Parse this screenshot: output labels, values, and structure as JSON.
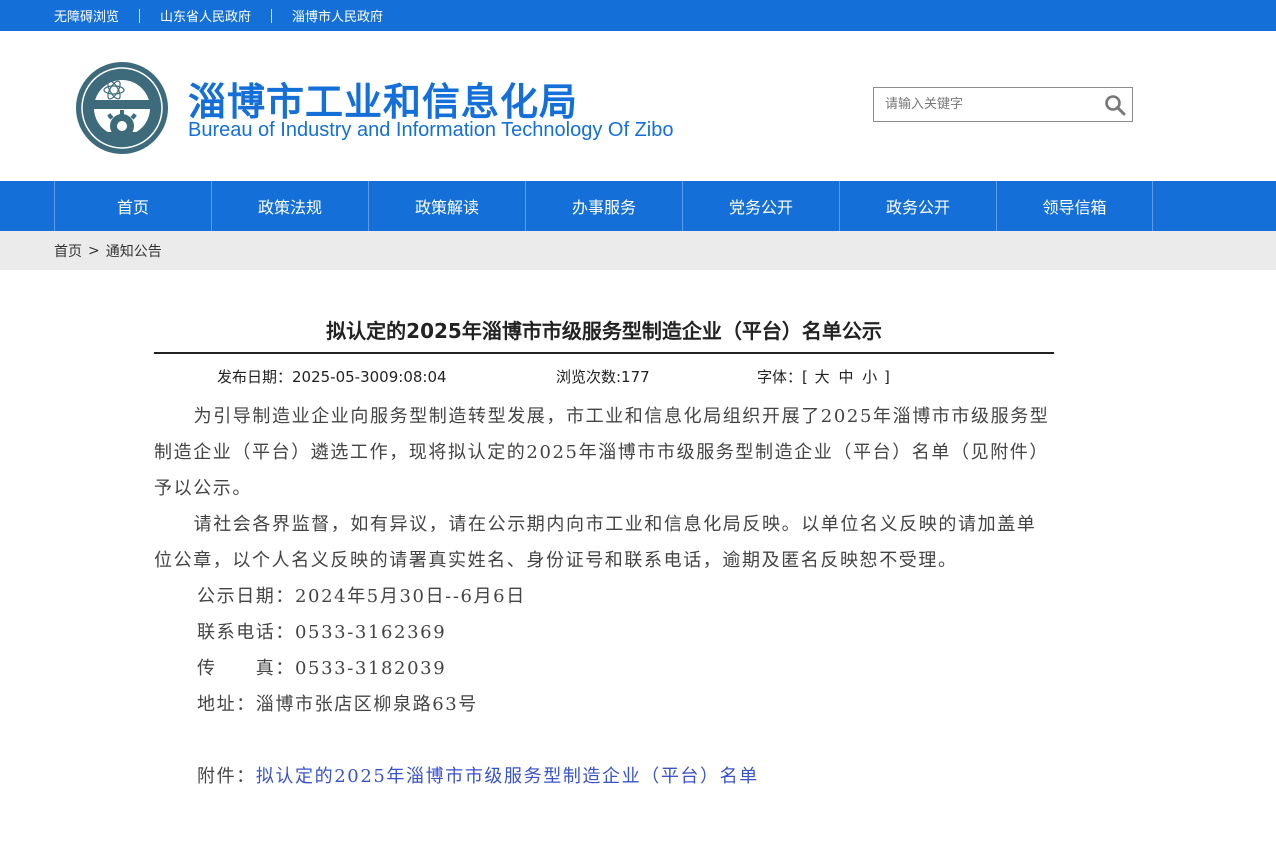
{
  "topbar": {
    "links": [
      "无障碍浏览",
      "山东省人民政府",
      "淄博市人民政府"
    ]
  },
  "header": {
    "title_cn": "淄博市工业和信息化局",
    "title_en": "Bureau of Industry and Information Technology Of Zibo",
    "search_placeholder": "请输入关键字"
  },
  "nav": {
    "items": [
      "首页",
      "政策法规",
      "政策解读",
      "办事服务",
      "党务公开",
      "政务公开",
      "领导信箱"
    ]
  },
  "breadcrumb": {
    "home": "首页",
    "separator": ">",
    "current": "通知公告"
  },
  "article": {
    "title": "拟认定的2025年淄博市市级服务型制造企业（平台）名单公示",
    "publish_date": "发布日期：2025-05-3009:08:04",
    "views": "浏览次数:177",
    "font_label": "字体：[",
    "font_large": "大",
    "font_medium": "中",
    "font_small": "小",
    "font_close": "]",
    "paragraph1": "为引导制造业企业向服务型制造转型发展，市工业和信息化局组织开展了2025年淄博市市级服务型制造企业（平台）遴选工作，现将拟认定的2025年淄博市市级服务型制造企业（平台）名单（见附件）予以公示。",
    "paragraph2": "请社会各界监督，如有异议，请在公示期内向市工业和信息化局反映。以单位名义反映的请加盖单位公章，以个人名义反映的请署真实姓名、身份证号和联系电话，逾期及匿名反映恕不受理。",
    "notice_period": "公示日期：2024年5月30日--6月6日",
    "phone": "联系电话：0533-3162369",
    "fax": "传　　真：0533-3182039",
    "address": "地址：淄博市张店区柳泉路63号",
    "attachment_label": "附件：",
    "attachment_link": "拟认定的2025年淄博市市级服务型制造企业（平台）名单"
  },
  "colors": {
    "brand_blue": "#1470d8",
    "breadcrumb_bg": "#ebebeb",
    "link_blue": "#3a53c9"
  },
  "icons": {
    "logo": "bureau-emblem-icon",
    "search": "search-icon"
  }
}
